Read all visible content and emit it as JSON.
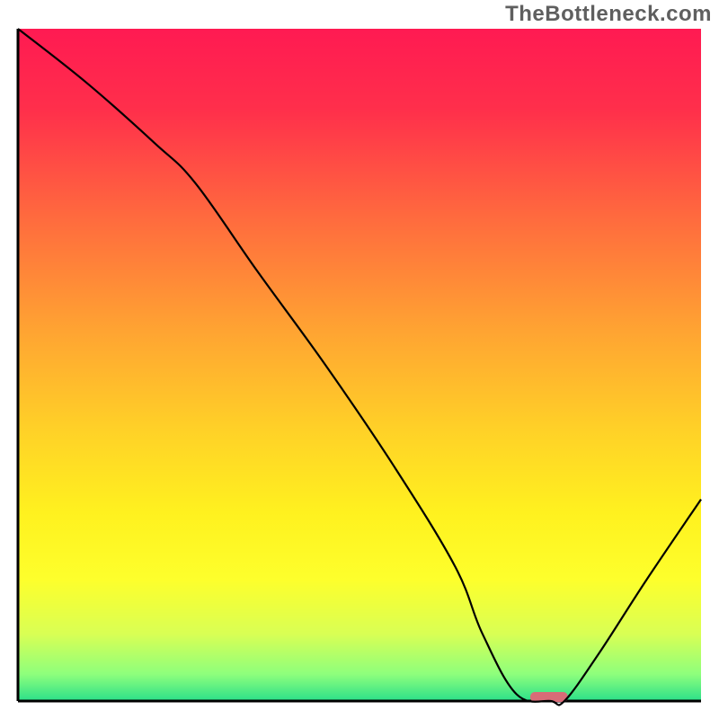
{
  "watermark": "TheBottleneck.com",
  "chart_data": {
    "type": "line",
    "title": "",
    "xlabel": "",
    "ylabel": "",
    "xlim": [
      0,
      100
    ],
    "ylim": [
      0,
      100
    ],
    "grid": false,
    "series": [
      {
        "name": "bottleneck-curve",
        "x": [
          0,
          10,
          20,
          26,
          35,
          45,
          55,
          64,
          68,
          73,
          78,
          80,
          85,
          92,
          100
        ],
        "y": [
          100,
          92,
          83,
          77,
          64,
          50,
          35,
          20,
          10,
          1,
          0,
          0,
          7,
          18,
          30
        ]
      }
    ],
    "marker": {
      "name": "sweet-spot",
      "x_start": 75,
      "x_end": 80.5,
      "y": 0,
      "color": "#d86b77"
    },
    "background_gradient": {
      "stops": [
        {
          "offset": 0.0,
          "color": "#ff1a52"
        },
        {
          "offset": 0.12,
          "color": "#ff2f4b"
        },
        {
          "offset": 0.28,
          "color": "#ff6a3e"
        },
        {
          "offset": 0.45,
          "color": "#ffa432"
        },
        {
          "offset": 0.6,
          "color": "#ffd227"
        },
        {
          "offset": 0.72,
          "color": "#fff11f"
        },
        {
          "offset": 0.82,
          "color": "#fdff2c"
        },
        {
          "offset": 0.9,
          "color": "#d9ff54"
        },
        {
          "offset": 0.96,
          "color": "#8eff7c"
        },
        {
          "offset": 1.0,
          "color": "#2bdf8a"
        }
      ]
    },
    "axis_color": "#000000",
    "line_color": "#000000",
    "line_width": 2.2
  }
}
